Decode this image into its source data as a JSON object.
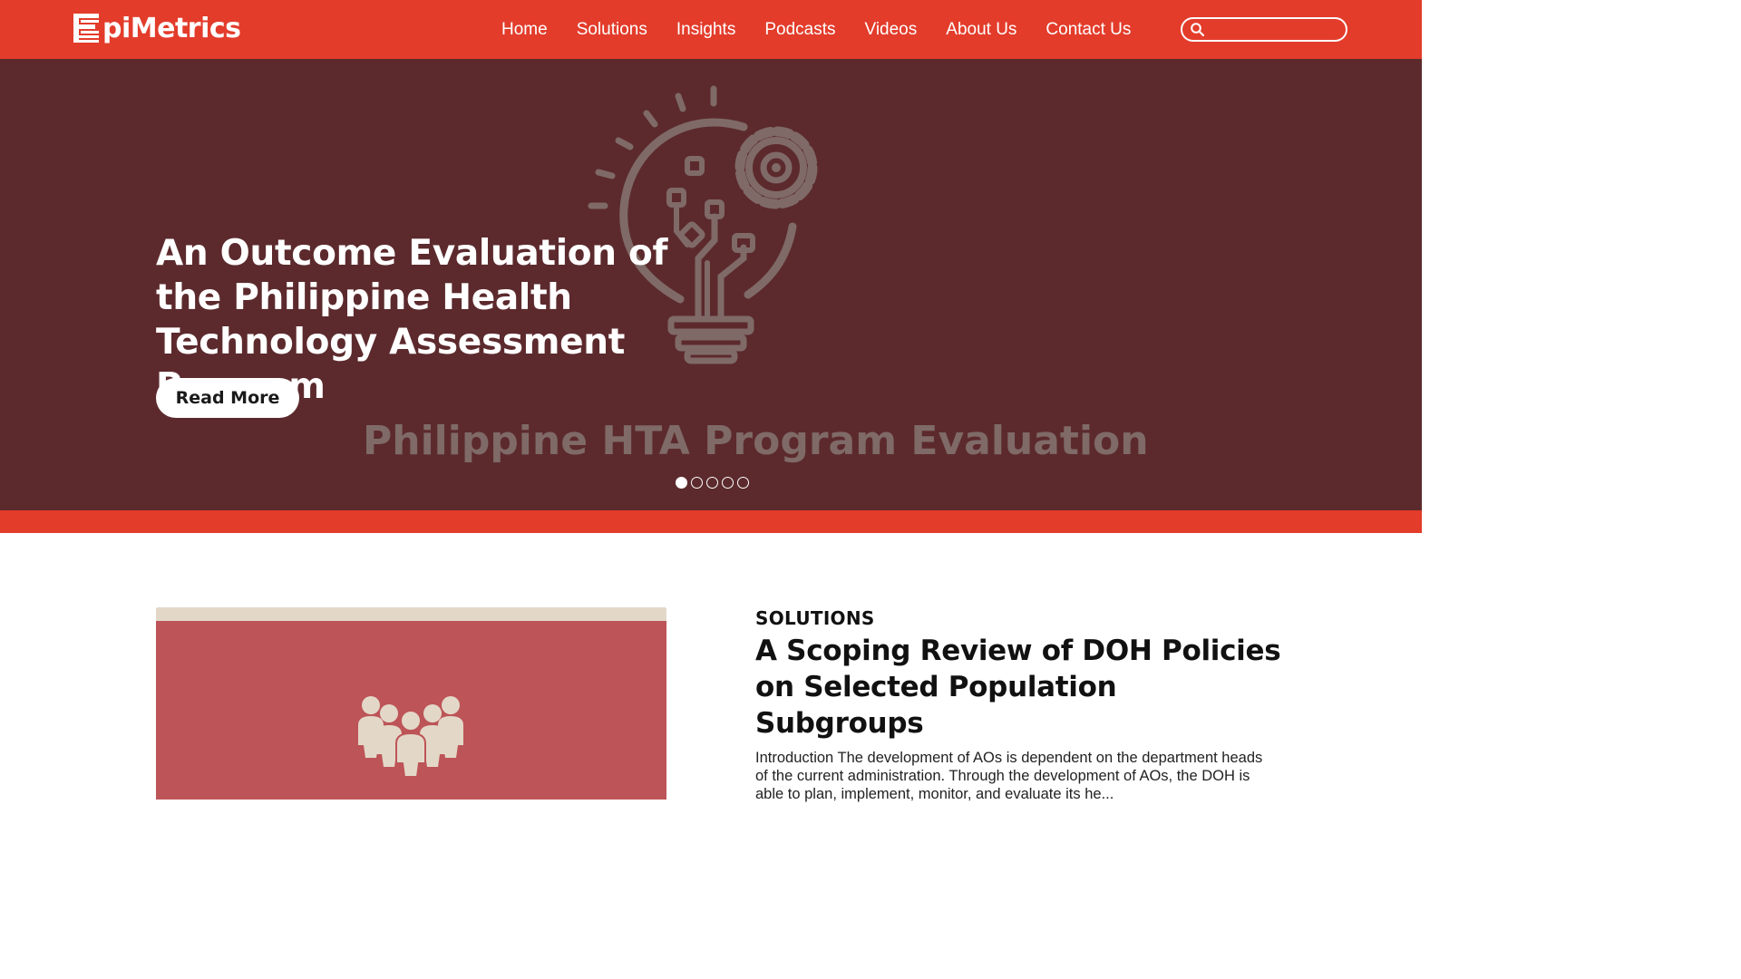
{
  "header": {
    "logo_text": "piMetrics",
    "nav": [
      "Home",
      "Solutions",
      "Insights",
      "Podcasts",
      "Videos",
      "About Us",
      "Contact Us"
    ],
    "search": {
      "placeholder": "",
      "value": ""
    }
  },
  "hero": {
    "title": "An Outcome Evaluation of the Philippine Health Technology Assessment Program",
    "button_label": "Read More",
    "watermark": "Philippine HTA Program Evaluation",
    "slides_total": 5,
    "active_slide": 1
  },
  "feature": {
    "category": "SOLUTIONS",
    "title": "A Scoping Review of DOH Policies on Selected Population Subgroups",
    "excerpt": "Introduction The development of AOs is dependent on the department heads of the current administration. Through the development of AOs, the DOH is able to plan, implement, monitor, and evaluate its he..."
  },
  "colors": {
    "brand_red": "#e33c2b",
    "hero_bg": "#5c2a2d",
    "card_image_bg": "#bd5457",
    "icon_beige": "#e3d8c8"
  },
  "icons": {
    "logo": "epimetrics-logo-icon",
    "search": "search-icon",
    "hero": "lightbulb-gear-icon",
    "card": "people-group-icon"
  }
}
